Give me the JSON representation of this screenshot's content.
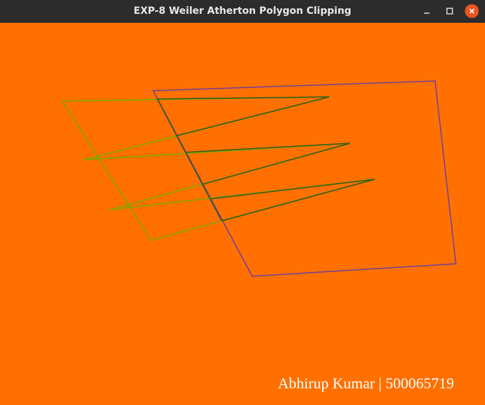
{
  "window": {
    "title": "EXP-8 Weiler Atherton Polygon Clipping"
  },
  "controls": {
    "minimize_icon": "minimize-icon",
    "maximize_icon": "maximize-icon",
    "close_icon": "close-icon"
  },
  "canvas": {
    "background_color": "#ff7000",
    "clip_window_color": "#6a3fa0",
    "subject_polygon_color": "#8aa000",
    "clipped_region_color": "#2f5a1a",
    "signature_text": "Abhirup Kumar | 500065719"
  }
}
